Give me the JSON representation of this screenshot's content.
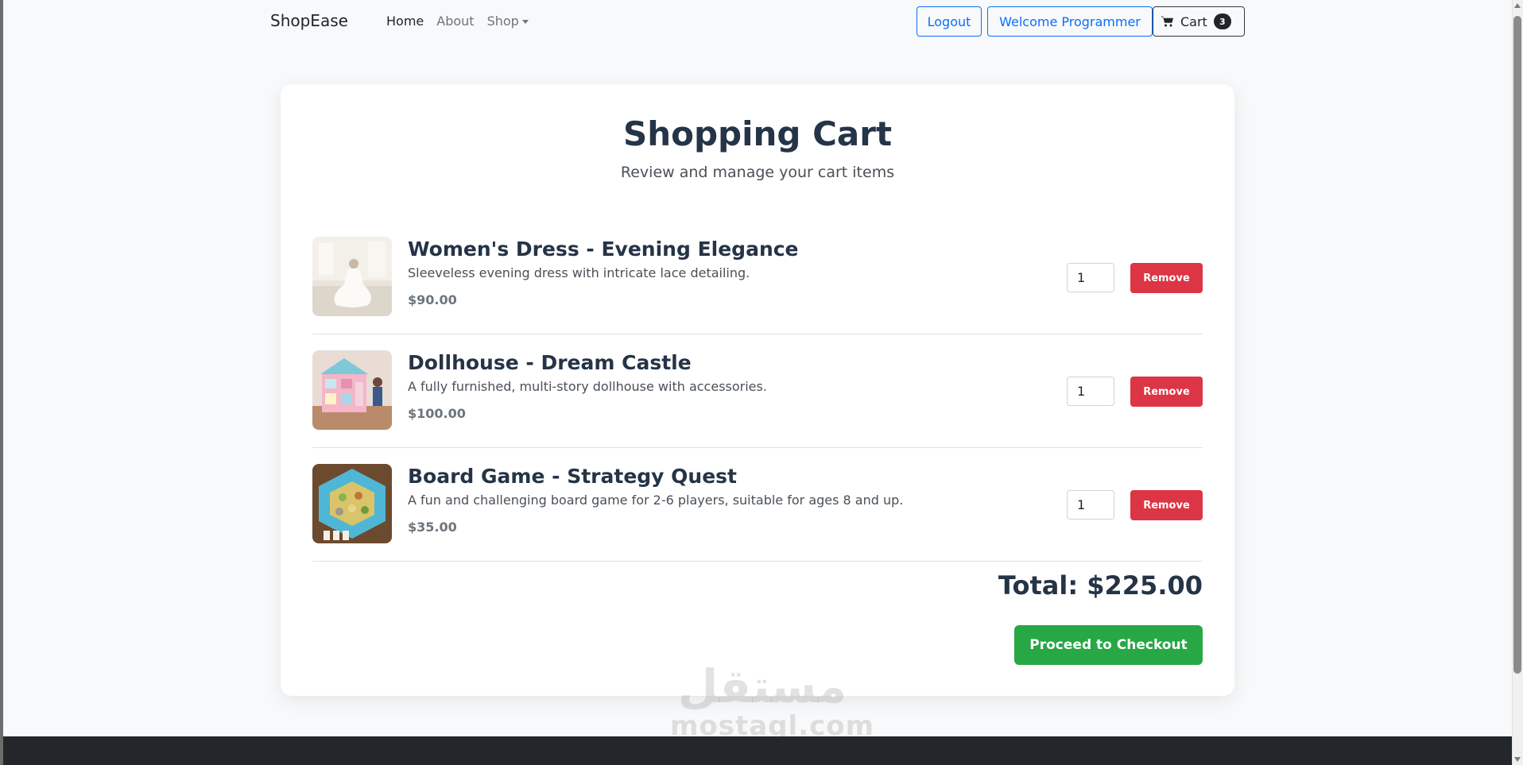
{
  "navbar": {
    "brand": "ShopEase",
    "links": [
      "Home",
      "About",
      "Shop"
    ],
    "logout_label": "Logout",
    "welcome_label": "Welcome Programmer",
    "cart_label": "Cart",
    "cart_count": "3"
  },
  "cart": {
    "title": "Shopping Cart",
    "subtitle": "Review and manage your cart items",
    "items": [
      {
        "name": "Women's Dress - Evening Elegance",
        "description": "Sleeveless evening dress with intricate lace detailing.",
        "price": "$90.00",
        "quantity": "1",
        "remove_label": "Remove"
      },
      {
        "name": "Dollhouse - Dream Castle",
        "description": "A fully furnished, multi-story dollhouse with accessories.",
        "price": "$100.00",
        "quantity": "1",
        "remove_label": "Remove"
      },
      {
        "name": "Board Game - Strategy Quest",
        "description": "A fun and challenging board game for 2-6 players, suitable for ages 8 and up.",
        "price": "$35.00",
        "quantity": "1",
        "remove_label": "Remove"
      }
    ],
    "total": "Total: $225.00",
    "checkout_label": "Proceed to Checkout"
  },
  "watermark": {
    "arabic": "مستقل",
    "latin": "mostaql.com"
  },
  "colors": {
    "primary": "#0d6efd",
    "danger": "#dc3545",
    "success": "#28a745",
    "heading": "#253446",
    "footer": "#23272b"
  }
}
